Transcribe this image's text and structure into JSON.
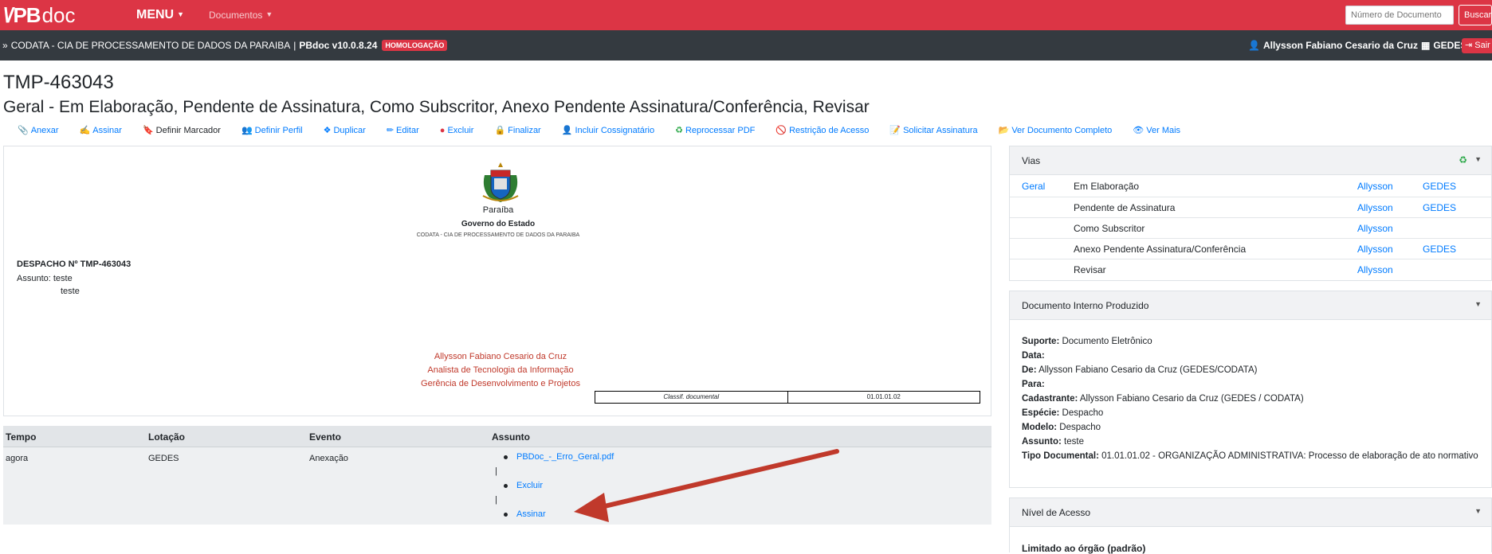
{
  "topbar": {
    "logo": {
      "mark": "\\/",
      "pb": "PB",
      "doc": "doc"
    },
    "menu_label": "MENU",
    "documents_label": "Documentos",
    "search_placeholder": "Número de Documento",
    "search_button": "Buscar",
    "bg_color": "#dc3545"
  },
  "darkbar": {
    "org": "CODATA - CIA DE PROCESSAMENTO DE DADOS DA PARAIBA",
    "sep": "|",
    "version": "PBdoc v10.0.8.24",
    "env_badge": "HOMOLOGAÇÃO",
    "user_name": "Allysson Fabiano Cesario da Cruz",
    "user_unit": "GEDES",
    "logout": "Sair"
  },
  "header": {
    "doc_id": "TMP-463043",
    "status_line": "Geral - Em Elaboração, Pendente de Assinatura, Como Subscritor, Anexo Pendente Assinatura/Conferência, Revisar"
  },
  "toolbar": [
    {
      "label": "Anexar",
      "icon": "paperclip-icon"
    },
    {
      "label": "Assinar",
      "icon": "sign-icon"
    },
    {
      "label": "Definir Marcador",
      "icon": "bookmark-icon"
    },
    {
      "label": "Definir Perfil",
      "icon": "profile-icon"
    },
    {
      "label": "Duplicar",
      "icon": "duplicate-icon"
    },
    {
      "label": "Editar",
      "icon": "pencil-icon"
    },
    {
      "label": "Excluir",
      "icon": "delete-icon"
    },
    {
      "label": "Finalizar",
      "icon": "lock-icon"
    },
    {
      "label": "Incluir Cossignatário",
      "icon": "user-add-icon"
    },
    {
      "label": "Reprocessar PDF",
      "icon": "refresh-icon"
    },
    {
      "label": "Restrição de Acesso",
      "icon": "restrict-icon"
    },
    {
      "label": "Solicitar Assinatura",
      "icon": "request-sign-icon"
    },
    {
      "label": "Ver Documento Completo",
      "icon": "folder-icon"
    },
    {
      "label": "Ver Mais",
      "icon": "eye-icon"
    }
  ],
  "preview": {
    "state": "Paraíba",
    "government": "Governo do Estado",
    "org": "CODATA - CIA DE PROCESSAMENTO DE DADOS DA PARAIBA",
    "despacho": "DESPACHO Nº TMP-463043",
    "assunto": "Assunto: teste",
    "body": "teste",
    "signer_name": "Allysson Fabiano Cesario da Cruz",
    "signer_role": "Analista de Tecnologia da Informação",
    "signer_unit": "Gerência de Desenvolvimento e Projetos",
    "classif_label": "Classif. documental",
    "classif_value": "01.01.01.02"
  },
  "movements": {
    "headers": [
      "Tempo",
      "Lotação",
      "Evento",
      "Assunto"
    ],
    "row": {
      "tempo": "agora",
      "lotacao": "GEDES",
      "evento": "Anexação",
      "items": [
        "PBDoc_-_Erro_Geral.pdf",
        "Excluir",
        "Assinar"
      ],
      "sep": "|"
    }
  },
  "vias": {
    "title": "Vias",
    "via": "Geral",
    "rows": [
      {
        "status": "Em Elaboração",
        "person": "Allysson",
        "unit": "GEDES"
      },
      {
        "status": "Pendente de Assinatura",
        "person": "Allysson",
        "unit": "GEDES"
      },
      {
        "status": "Como Subscritor",
        "person": "Allysson",
        "unit": ""
      },
      {
        "status": "Anexo Pendente Assinatura/Conferência",
        "person": "Allysson",
        "unit": "GEDES"
      },
      {
        "status": "Revisar",
        "person": "Allysson",
        "unit": ""
      }
    ]
  },
  "doc_info": {
    "title": "Documento Interno Produzido",
    "suporte_label": "Suporte:",
    "suporte": "Documento Eletrônico",
    "data_label": "Data:",
    "de_label": "De:",
    "de": "Allysson Fabiano Cesario da Cruz (GEDES/CODATA)",
    "para_label": "Para:",
    "cadastrante_label": "Cadastrante:",
    "cadastrante": "Allysson Fabiano Cesario da Cruz (GEDES / CODATA)",
    "especie_label": "Espécie:",
    "especie": "Despacho",
    "modelo_label": "Modelo:",
    "modelo": "Despacho",
    "assunto_label": "Assunto:",
    "assunto": "teste",
    "tipo_label": "Tipo Documental:",
    "tipo": "01.01.01.02 - ORGANIZAÇÃO ADMINISTRATIVA: Processo de elaboração de ato normativo"
  },
  "access": {
    "title": "Nível de Acesso",
    "value": "Limitado ao órgão (padrão)"
  },
  "annotation": {
    "arrow_color": "#c0392b"
  }
}
